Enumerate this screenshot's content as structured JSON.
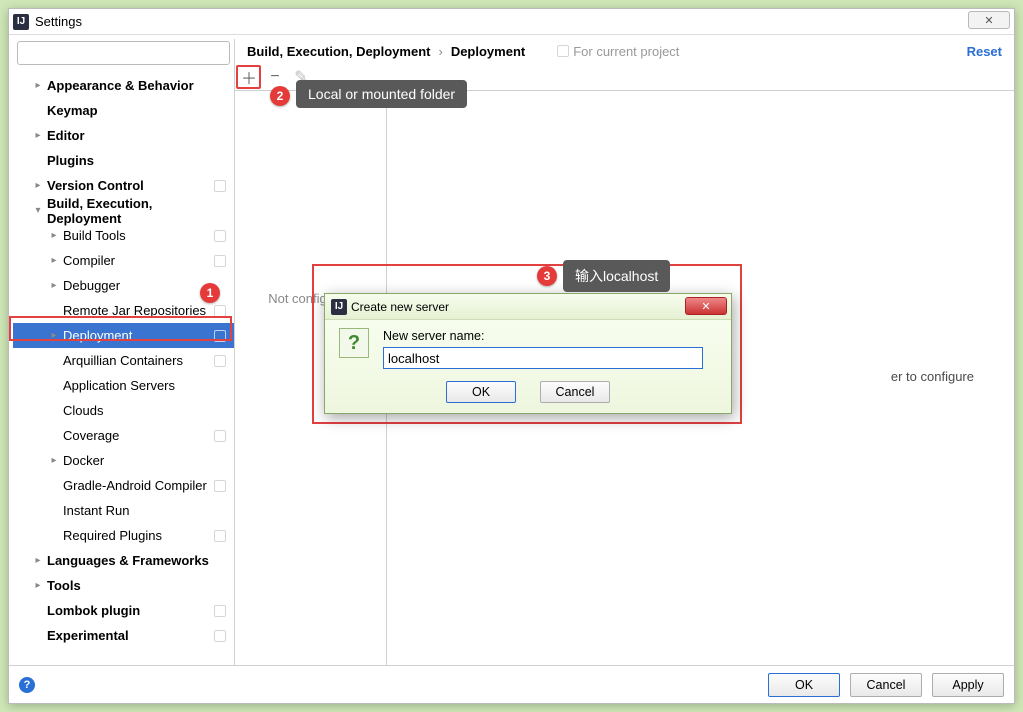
{
  "window": {
    "title": "Settings"
  },
  "breadcrumb": {
    "a": "Build, Execution, Deployment",
    "b": "Deployment"
  },
  "forProject": "For current project",
  "resetLabel": "Reset",
  "listEmpty": "Not configured",
  "detailHelp": "er to configure",
  "sidebar": [
    {
      "label": "Appearance & Behavior",
      "bold": true,
      "arrow": "r",
      "lvl": 1
    },
    {
      "label": "Keymap",
      "bold": true,
      "lvl": 1
    },
    {
      "label": "Editor",
      "bold": true,
      "arrow": "r",
      "lvl": 1
    },
    {
      "label": "Plugins",
      "bold": true,
      "lvl": 1
    },
    {
      "label": "Version Control",
      "bold": true,
      "arrow": "r",
      "lvl": 1,
      "proj": true
    },
    {
      "label": "Build, Execution, Deployment",
      "bold": true,
      "arrow": "d",
      "lvl": 1
    },
    {
      "label": "Build Tools",
      "arrow": "r",
      "lvl": 2,
      "proj": true
    },
    {
      "label": "Compiler",
      "arrow": "r",
      "lvl": 2,
      "proj": true
    },
    {
      "label": "Debugger",
      "arrow": "r",
      "lvl": 2
    },
    {
      "label": "Remote Jar Repositories",
      "lvl": 2,
      "proj": true
    },
    {
      "label": "Deployment",
      "arrow": "r",
      "lvl": 2,
      "proj": true,
      "selected": true
    },
    {
      "label": "Arquillian Containers",
      "lvl": 2,
      "proj": true
    },
    {
      "label": "Application Servers",
      "lvl": 2
    },
    {
      "label": "Clouds",
      "lvl": 2
    },
    {
      "label": "Coverage",
      "lvl": 2,
      "proj": true
    },
    {
      "label": "Docker",
      "arrow": "r",
      "lvl": 2
    },
    {
      "label": "Gradle-Android Compiler",
      "lvl": 2,
      "proj": true
    },
    {
      "label": "Instant Run",
      "lvl": 2
    },
    {
      "label": "Required Plugins",
      "lvl": 2,
      "proj": true
    },
    {
      "label": "Languages & Frameworks",
      "bold": true,
      "arrow": "r",
      "lvl": 1
    },
    {
      "label": "Tools",
      "bold": true,
      "arrow": "r",
      "lvl": 1
    },
    {
      "label": "Lombok plugin",
      "bold": true,
      "lvl": 1,
      "proj": true
    },
    {
      "label": "Experimental",
      "bold": true,
      "lvl": 1,
      "proj": true
    }
  ],
  "badges": {
    "b1": "1",
    "b2": "2",
    "b3": "3"
  },
  "tips": {
    "t2": "Local or mounted folder",
    "t3": "输入localhost"
  },
  "modal": {
    "title": "Create new server",
    "label": "New server name:",
    "value": "localhost",
    "ok": "OK",
    "cancel": "Cancel"
  },
  "footer": {
    "ok": "OK",
    "cancel": "Cancel",
    "apply": "Apply"
  }
}
